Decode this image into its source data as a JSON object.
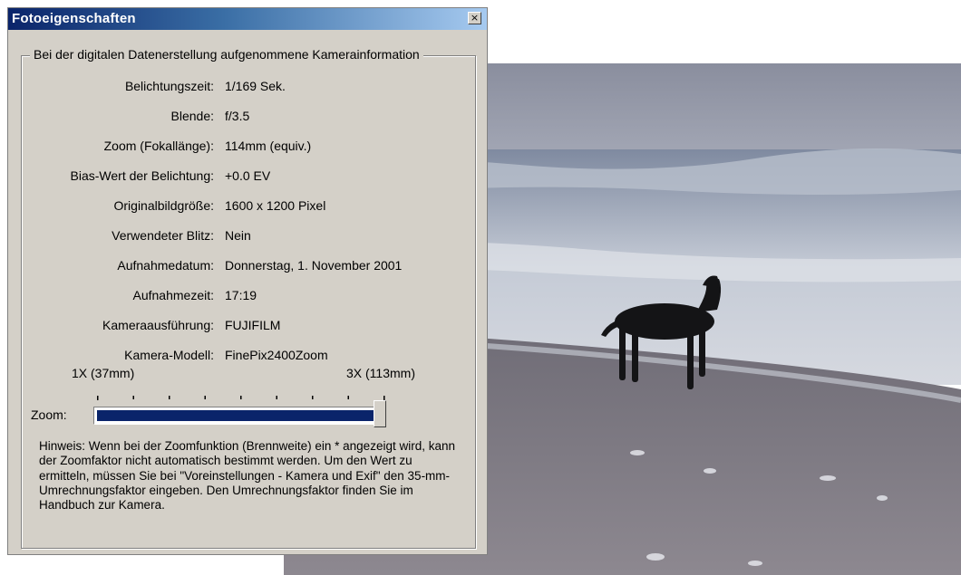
{
  "window": {
    "title": "Fotoeigenschaften",
    "close_glyph": "×",
    "close_icon": "close-icon"
  },
  "group": {
    "legend": "Bei der digitalen Datenerstellung aufgenommene Kamerainformation"
  },
  "info": [
    {
      "label": "Belichtungszeit:",
      "value": "1/169 Sek."
    },
    {
      "label": "Blende:",
      "value": "f/3.5"
    },
    {
      "label": "Zoom (Fokallänge):",
      "value": "114mm (equiv.)"
    },
    {
      "label": "Bias-Wert der Belichtung:",
      "value": "+0.0 EV"
    },
    {
      "label": "Originalbildgröße:",
      "value": "1600 x 1200 Pixel"
    },
    {
      "label": "Verwendeter Blitz:",
      "value": "Nein"
    },
    {
      "label": "Aufnahmedatum:",
      "value": "Donnerstag, 1. November 2001"
    },
    {
      "label": "Aufnahmezeit:",
      "value": "17:19"
    },
    {
      "label": "Kameraausführung:",
      "value": "FUJIFILM"
    },
    {
      "label": "Kamera-Modell:",
      "value": "FinePix2400Zoom"
    }
  ],
  "zoom": {
    "label": "Zoom:",
    "min_label": "1X (37mm)",
    "max_label": "3X (113mm)",
    "level": 1.0
  },
  "hint": "Hinweis: Wenn bei der Zoomfunktion (Brennweite) ein * angezeigt wird, kann der Zoomfaktor nicht automatisch bestimmt werden. Um den Wert zu ermitteln, müssen Sie bei \"Voreinstellungen - Kamera und Exif\" den 35-mm-Umrechnungsfaktor eingeben. Den Umrechnungsfaktor finden Sie im Handbuch zur Kamera.",
  "colors": {
    "titlebar_start": "#0a246a",
    "titlebar_end": "#a6caf0",
    "dialog_bg": "#d4d0c8",
    "zoom_fill": "#0a246a"
  }
}
